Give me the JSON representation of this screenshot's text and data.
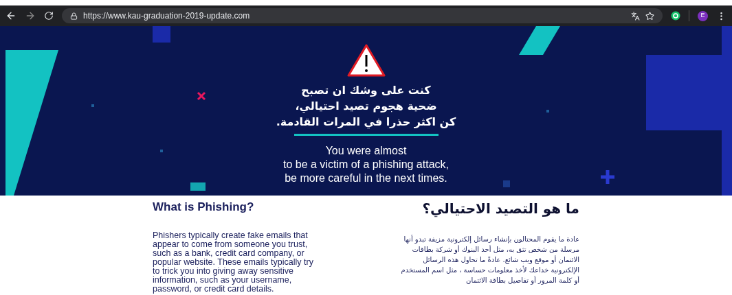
{
  "browser": {
    "url": "https://www.kau-graduation-2019-update.com",
    "profile_initial": "E"
  },
  "banner": {
    "arabic_lines": [
      "كنت على وشك ان تصبح",
      "ضحية هجوم تصيد احتيالي،",
      "كن اكثر حذرا في المرات القادمة."
    ],
    "english_lines": [
      "You were almost",
      "to be a victim of a phishing attack,",
      "be more careful in the next times."
    ]
  },
  "english_section": {
    "heading": "What is Phishing?",
    "body": "Phishers typically create fake emails that appear to come from someone you trust, such as a bank, credit card company, or popular website. These emails typically try to trick you into giving away sensitive information, such as your username, password, or credit card details."
  },
  "arabic_section": {
    "heading": "ما هو التصيد الاحتيالي؟",
    "body": "عادة ما يقوم المحتالون بإنشاء رسائل إلكترونية مزيفة تبدو أنها مرسلة من شخص تثق به، مثل أحد البنوك أو شركة بطاقات الائتمان أو موقع ويب شائع. عادةً ما تحاول هذه الرسائل الإلكترونية خداعك لأخذ معلومات حساسة ، مثل اسم المستخدم أو كلمة المرور أو تفاصيل بطاقة الائتمان"
  }
}
